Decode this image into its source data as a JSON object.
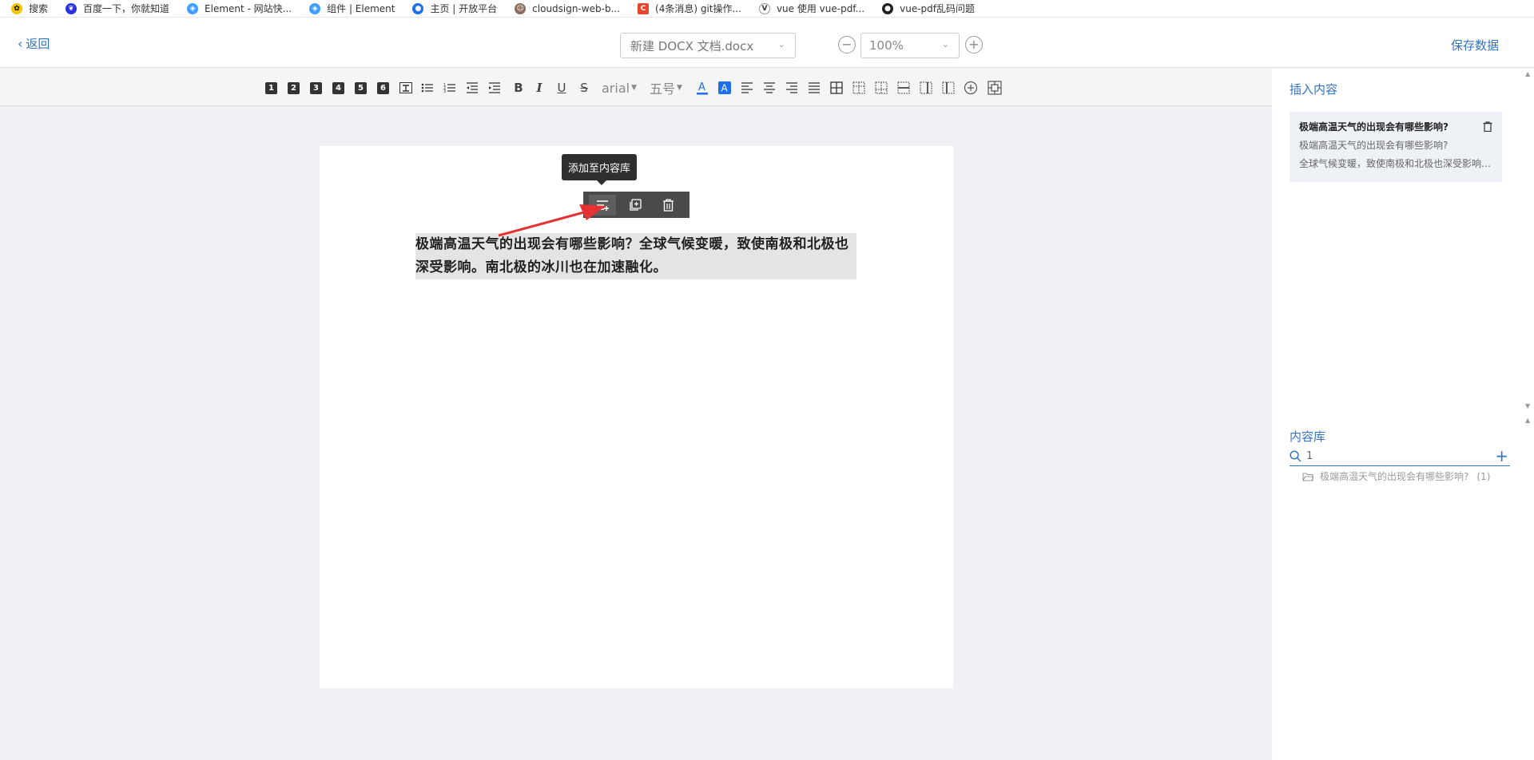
{
  "bookmarks": [
    {
      "label": "搜索",
      "color": "#1a1a1a"
    },
    {
      "label": "百度一下，你就知道",
      "color": "#2932e1"
    },
    {
      "label": "Element - 网站快...",
      "color": "#409eff"
    },
    {
      "label": "组件 | Element",
      "color": "#409eff"
    },
    {
      "label": "主页 | 开放平台",
      "color": "#1f6feb"
    },
    {
      "label": "cloudsign-web-b...",
      "color": "#8a6d5a"
    },
    {
      "label": "(4条消息) git操作...",
      "color": "#e8472e"
    },
    {
      "label": "vue 使用 vue-pdf...",
      "color": "#333333"
    },
    {
      "label": "vue-pdf乱码问题",
      "color": "#222222"
    }
  ],
  "header": {
    "back_label": "返回",
    "file_name": "新建 DOCX 文档.docx",
    "zoom_value": "100%",
    "zoom_out": "−",
    "zoom_in": "+",
    "save_label": "保存数据"
  },
  "toolbar": {
    "headings": [
      "1",
      "2",
      "3",
      "4",
      "5",
      "6"
    ],
    "font_family": "arial",
    "font_size": "五号",
    "bold": "B",
    "italic": "I",
    "underline": "U",
    "strike": "S"
  },
  "document": {
    "paragraph": "极端高温天气的出现会有哪些影响？全球气候变暖，致使南极和北极也深受影响。南北极的冰川也在加速融化。",
    "tooltip": "添加至内容库"
  },
  "sidebar": {
    "insert_title": "插入内容",
    "card": {
      "title": "极端高温天气的出现会有哪些影响?",
      "line1": "极端高温天气的出现会有哪些影响?",
      "line2": "全球气候变暖，致使南极和北极也深受影响。南北极的冰川也在加速融化。"
    },
    "library_title": "内容库",
    "search_value": "1",
    "folder_name": "极端高温天气的出现会有哪些影响?",
    "folder_count": "(1)"
  },
  "colors": {
    "accent": "#3473c0",
    "arrow": "#e53232"
  }
}
